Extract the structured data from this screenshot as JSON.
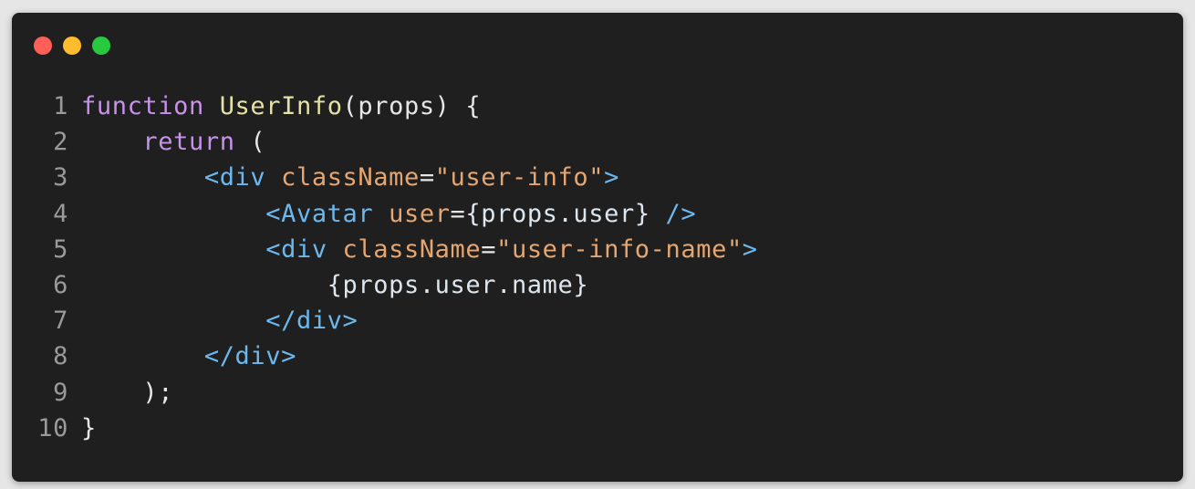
{
  "window": {
    "buttons": [
      {
        "name": "close",
        "color": "#ff5f56"
      },
      {
        "name": "minimize",
        "color": "#ffbd2e"
      },
      {
        "name": "zoom",
        "color": "#27c93f"
      }
    ]
  },
  "colors": {
    "keyword": "#c792ea",
    "function": "#e6e2a6",
    "tag": "#6cb8ee",
    "attr": "#e5a672",
    "string": "#e5a672",
    "plain": "#e6e6e6",
    "variable": "#dde6ee",
    "punct": "#e6e6e6",
    "line_number": "#9a9a9a"
  },
  "code": {
    "lines": [
      {
        "number": "1",
        "tokens": [
          {
            "text": "function",
            "type": "keyword"
          },
          {
            "text": " ",
            "type": "plain"
          },
          {
            "text": "UserInfo",
            "type": "function"
          },
          {
            "text": "(props) {",
            "type": "plain"
          }
        ]
      },
      {
        "number": "2",
        "tokens": [
          {
            "text": "    ",
            "type": "plain"
          },
          {
            "text": "return",
            "type": "keyword"
          },
          {
            "text": " (",
            "type": "plain"
          }
        ]
      },
      {
        "number": "3",
        "tokens": [
          {
            "text": "        ",
            "type": "plain"
          },
          {
            "text": "<div",
            "type": "tag"
          },
          {
            "text": " ",
            "type": "plain"
          },
          {
            "text": "className",
            "type": "attr"
          },
          {
            "text": "=",
            "type": "plain"
          },
          {
            "text": "\"user-info\"",
            "type": "string"
          },
          {
            "text": ">",
            "type": "tag"
          }
        ]
      },
      {
        "number": "4",
        "tokens": [
          {
            "text": "            ",
            "type": "plain"
          },
          {
            "text": "<Avatar",
            "type": "tag"
          },
          {
            "text": " ",
            "type": "plain"
          },
          {
            "text": "user",
            "type": "attr"
          },
          {
            "text": "=",
            "type": "plain"
          },
          {
            "text": "{props.user}",
            "type": "variable"
          },
          {
            "text": " ",
            "type": "plain"
          },
          {
            "text": "/>",
            "type": "tag"
          }
        ]
      },
      {
        "number": "5",
        "tokens": [
          {
            "text": "            ",
            "type": "plain"
          },
          {
            "text": "<div",
            "type": "tag"
          },
          {
            "text": " ",
            "type": "plain"
          },
          {
            "text": "className",
            "type": "attr"
          },
          {
            "text": "=",
            "type": "plain"
          },
          {
            "text": "\"user-info-name\"",
            "type": "string"
          },
          {
            "text": ">",
            "type": "tag"
          }
        ]
      },
      {
        "number": "6",
        "tokens": [
          {
            "text": "                ",
            "type": "plain"
          },
          {
            "text": "{props.user.name}",
            "type": "variable"
          }
        ]
      },
      {
        "number": "7",
        "tokens": [
          {
            "text": "            ",
            "type": "plain"
          },
          {
            "text": "</div>",
            "type": "tag"
          }
        ]
      },
      {
        "number": "8",
        "tokens": [
          {
            "text": "        ",
            "type": "plain"
          },
          {
            "text": "</div>",
            "type": "tag"
          }
        ]
      },
      {
        "number": "9",
        "tokens": [
          {
            "text": "    );",
            "type": "plain"
          }
        ]
      },
      {
        "number": "10",
        "tokens": [
          {
            "text": "}",
            "type": "plain"
          }
        ]
      }
    ]
  }
}
